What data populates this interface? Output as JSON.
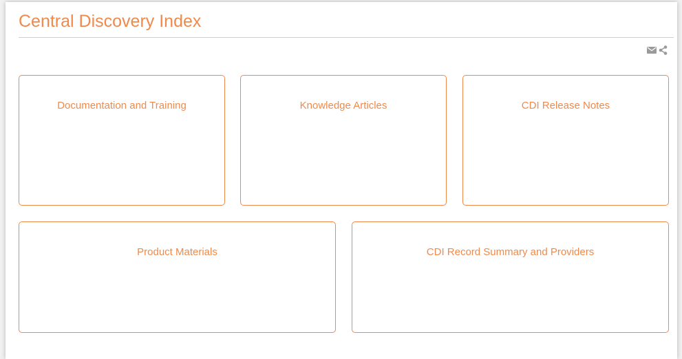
{
  "page": {
    "title": "Central Discovery Index"
  },
  "toolbar": {
    "icons": [
      "email-icon",
      "share-icon"
    ]
  },
  "tiles": [
    {
      "label": "Documentation and Training"
    },
    {
      "label": "Knowledge Articles"
    },
    {
      "label": "CDI Release Notes"
    },
    {
      "label": "Product Materials"
    },
    {
      "label": "CDI Record Summary and Providers"
    }
  ],
  "colors": {
    "accent": "#f08a4b",
    "rule": "#cfcfcf",
    "icon": "#9a9a9a"
  }
}
